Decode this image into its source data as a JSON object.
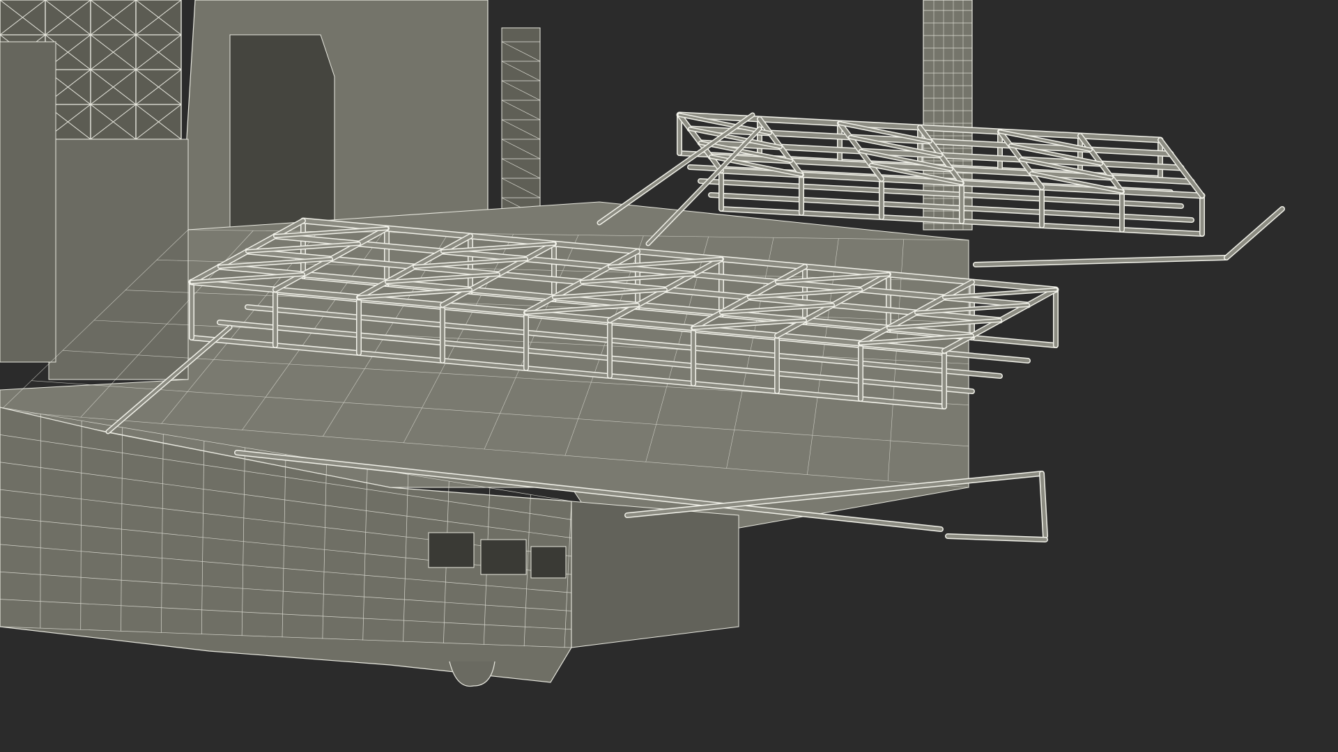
{
  "scene": {
    "subject": "wireframe-render-offshore-vessel-deck-structures",
    "colors": {
      "background": "#2b2b2b",
      "hull_fill": "#6f6f65",
      "hull_dark": "#5e5e55",
      "deck_fill": "#7a7a70",
      "wire": "#e9e9e0",
      "tube_fill": "#8c8c82",
      "tube_edge": "#f2f2ea",
      "shadow": "#55554d"
    },
    "icons": {
      "hull": "ship-hull-icon",
      "truss": "truss-frame-icon",
      "tower": "derrick-tower-icon",
      "chimney": "chimney-icon"
    }
  }
}
